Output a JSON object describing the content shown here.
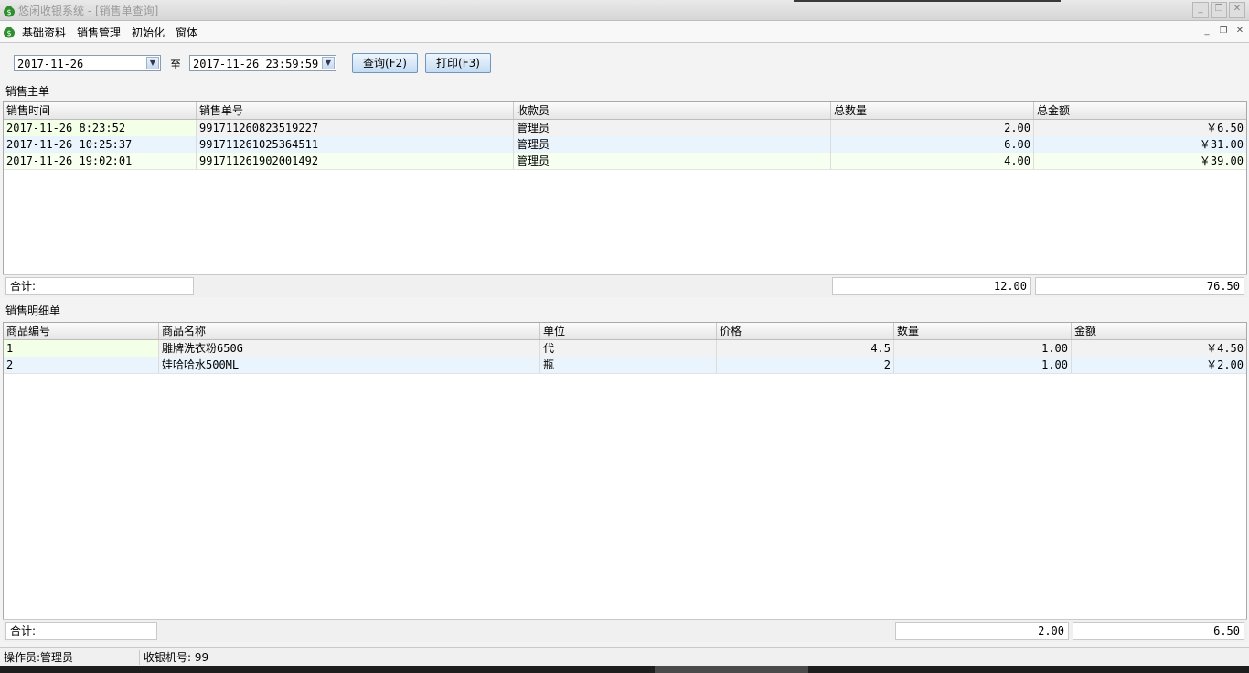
{
  "window": {
    "title": "悠闲收银系统 - [销售单查询]"
  },
  "menu": {
    "items": [
      "基础资料",
      "销售管理",
      "初始化",
      "窗体"
    ]
  },
  "filter": {
    "start_date": "2017-11-26",
    "to_label": "至",
    "end_date": "2017-11-26 23:59:59",
    "query_button": "查询(F2)",
    "print_button": "打印(F3)"
  },
  "master": {
    "label": "销售主单",
    "columns": [
      "销售时间",
      "销售单号",
      "收款员",
      "总数量",
      "总金额"
    ],
    "rows": [
      [
        "2017-11-26 8:23:52",
        "991711260823519227",
        "管理员",
        "2.00",
        "￥6.50"
      ],
      [
        "2017-11-26 10:25:37",
        "991711261025364511",
        "管理员",
        "6.00",
        "￥31.00"
      ],
      [
        "2017-11-26 19:02:01",
        "991711261902001492",
        "管理员",
        "4.00",
        "￥39.00"
      ]
    ],
    "total_label": "合计:",
    "total_qty": "12.00",
    "total_amount": "76.50"
  },
  "detail": {
    "label": "销售明细单",
    "columns": [
      "商品编号",
      "商品名称",
      "单位",
      "价格",
      "数量",
      "金额"
    ],
    "rows": [
      [
        "1",
        "雕牌洗衣粉650G",
        "代",
        "4.5",
        "1.00",
        "￥4.50"
      ],
      [
        "2",
        "娃哈哈水500ML",
        "瓶",
        "2",
        "1.00",
        "￥2.00"
      ]
    ],
    "total_label": "合计:",
    "total_qty": "2.00",
    "total_amount": "6.50"
  },
  "status": {
    "operator": "操作员:管理员",
    "terminal": "收银机号: 99"
  },
  "colors": {
    "accent": "#c4dcf3",
    "row_alt": "#eaf4fc",
    "first_col": "#f4ffe8"
  }
}
